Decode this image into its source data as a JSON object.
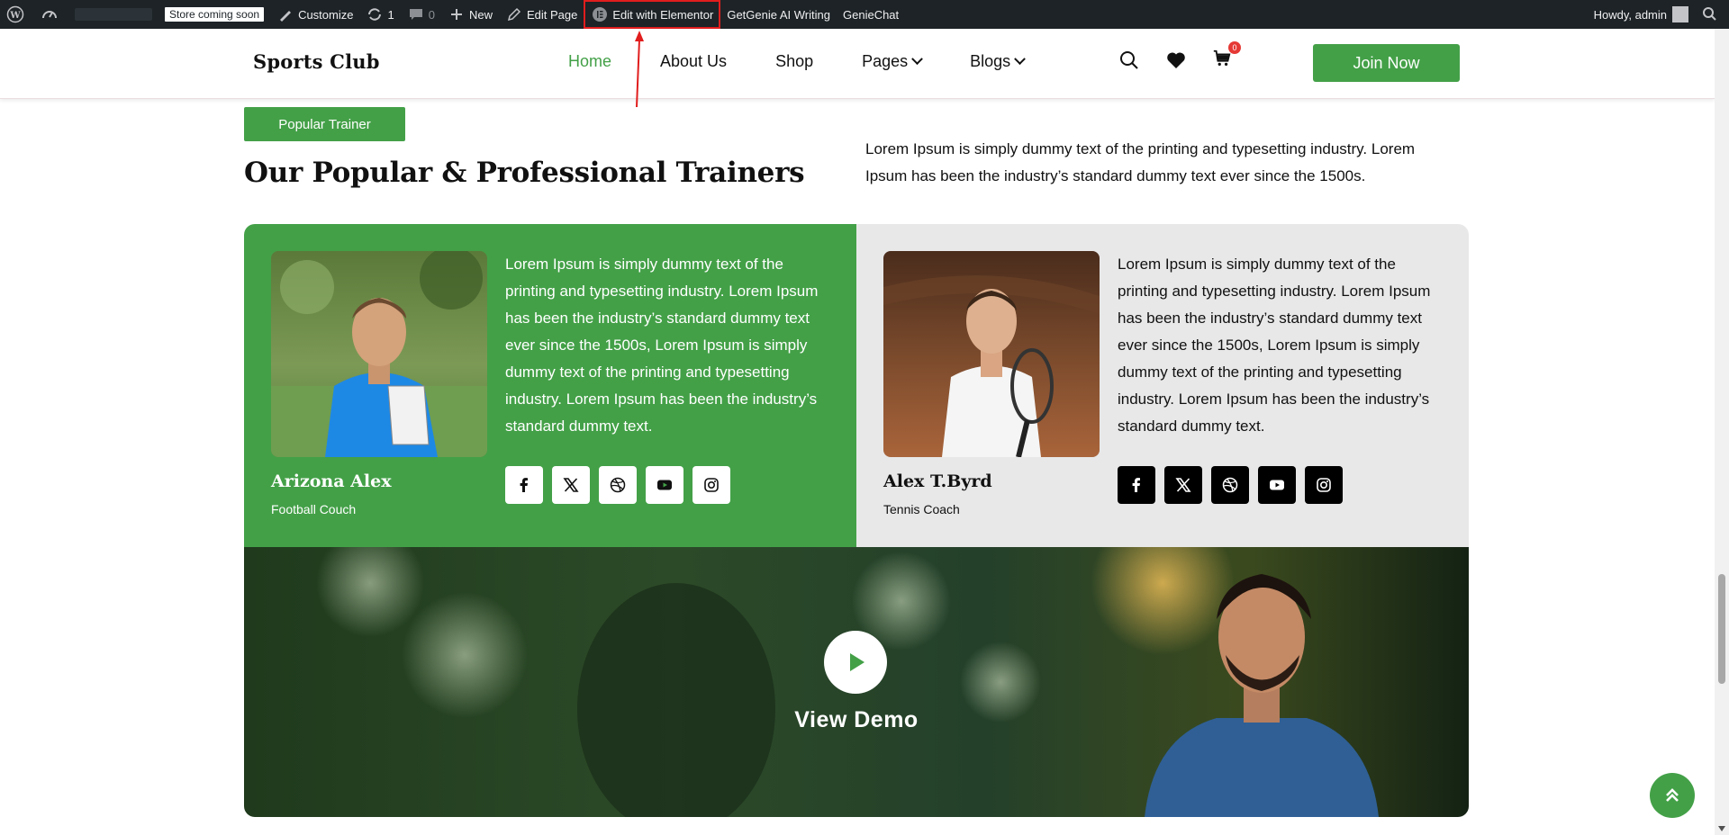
{
  "adminbar": {
    "store_badge": "Store coming soon",
    "customize": "Customize",
    "updates_count": "1",
    "comments_count": "0",
    "new": "New",
    "edit_page": "Edit Page",
    "edit_elementor": "Edit with Elementor",
    "getgenie": "GetGenie AI Writing",
    "geniechat": "GenieChat",
    "howdy": "Howdy, admin"
  },
  "header": {
    "logo": "Sports Club",
    "nav": [
      "Home",
      "About Us",
      "Shop",
      "Pages",
      "Blogs"
    ],
    "cart_count": "0",
    "join_label": "Join Now"
  },
  "section": {
    "badge": "Popular Trainer",
    "title": "Our Popular & Professional Trainers",
    "description": "Lorem Ipsum is simply dummy text of the printing and typesetting industry. Lorem Ipsum has been the industry’s standard dummy text ever since the 1500s."
  },
  "trainers": [
    {
      "name": "Arizona Alex",
      "role": "Football Couch",
      "bio": "Lorem Ipsum is simply dummy text of the printing and typesetting industry. Lorem Ipsum has been the industry’s standard dummy text ever since the 1500s, Lorem Ipsum is simply dummy text of the printing and typesetting industry. Lorem Ipsum has been the industry’s standard dummy text."
    },
    {
      "name": "Alex T.Byrd",
      "role": "Tennis Coach",
      "bio": "Lorem Ipsum is simply dummy text of the printing and typesetting industry. Lorem Ipsum has been the industry’s standard dummy text ever since the 1500s, Lorem Ipsum is simply dummy text of the printing and typesetting industry. Lorem Ipsum has been the industry’s standard dummy text."
    }
  ],
  "social_icons": [
    "facebook-icon",
    "x-icon",
    "dribbble-icon",
    "youtube-icon",
    "instagram-icon"
  ],
  "video": {
    "label": "View Demo"
  },
  "colors": {
    "accent": "#43a047",
    "adminbar": "#1d2327",
    "annotation": "#e11d1d"
  }
}
